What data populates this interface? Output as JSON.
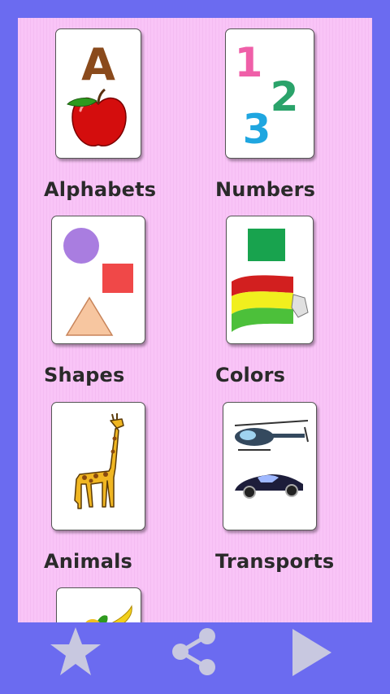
{
  "categories": [
    {
      "label": "Alphabets",
      "icon": "apple-letter-a-icon"
    },
    {
      "label": "Numbers",
      "icon": "numbers-123-icon"
    },
    {
      "label": "Shapes",
      "icon": "shapes-icon"
    },
    {
      "label": "Colors",
      "icon": "paint-flag-icon"
    },
    {
      "label": "Animals",
      "icon": "giraffe-icon"
    },
    {
      "label": "Transports",
      "icon": "helicopter-car-icon"
    },
    {
      "label": "",
      "icon": "fruits-icon"
    }
  ],
  "toolbar": {
    "buttons": [
      {
        "icon": "star-icon"
      },
      {
        "icon": "share-icon"
      },
      {
        "icon": "play-icon"
      }
    ]
  },
  "colors": {
    "frame": "#6b6bf0",
    "panel": "#f9c4f7",
    "toolbar_icon": "#c8c8e0"
  }
}
